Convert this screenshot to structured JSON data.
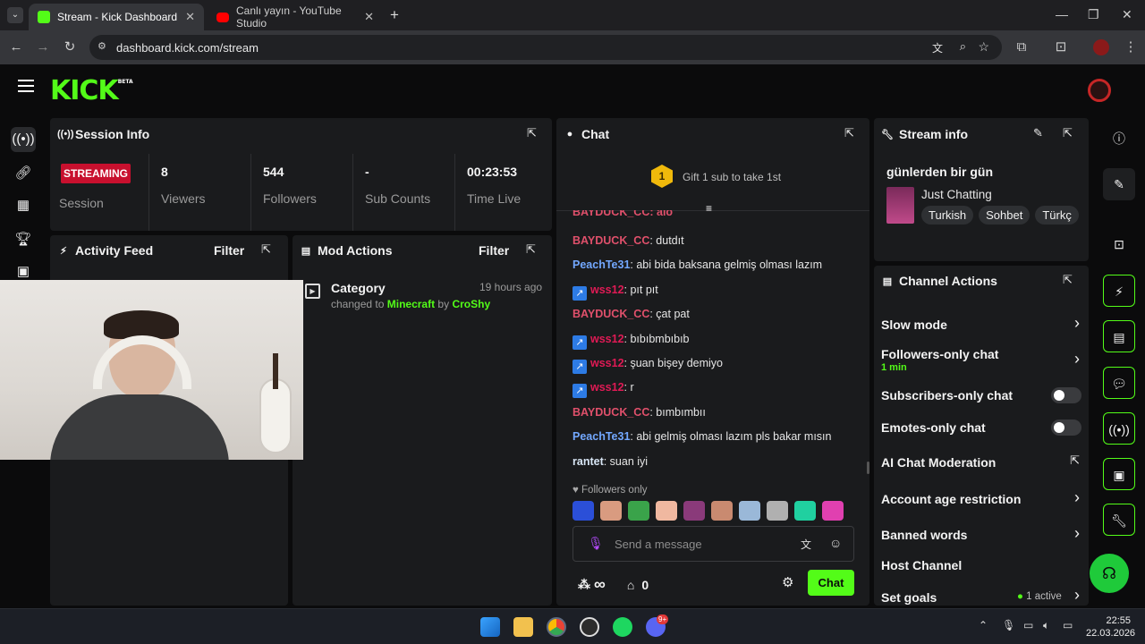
{
  "browser": {
    "tabs": [
      {
        "title": "Stream - Kick Dashboard",
        "active": true
      },
      {
        "title": "Canlı yayın - YouTube Studio",
        "active": false
      }
    ],
    "url": "dashboard.kick.com/stream",
    "close_glyph": "✕",
    "new_tab_glyph": "+"
  },
  "header": {
    "logo": "KICK",
    "logo_badge": "BETA"
  },
  "session": {
    "title": "Session Info",
    "status_badge": "STREAMING",
    "session_label": "Session",
    "stats": [
      {
        "value": "8",
        "label": "Viewers"
      },
      {
        "value": "544",
        "label": "Followers"
      },
      {
        "value": "-",
        "label": "Sub Counts"
      },
      {
        "value": "00:23:53",
        "label": "Time Live"
      }
    ]
  },
  "activity": {
    "title": "Activity Feed",
    "filter": "Filter"
  },
  "mod": {
    "title": "Mod Actions",
    "filter": "Filter",
    "entry": {
      "title": "Category",
      "time": "19 hours ago",
      "prefix": "changed to",
      "category": "Minecraft",
      "by": "by",
      "user": "CroShy"
    }
  },
  "chat": {
    "title": "Chat",
    "gift_count": "1",
    "gift_text": "Gift 1 sub to take 1st",
    "partial_line": "BAYDUCK_CC: alo",
    "messages": [
      {
        "user": "BAYDUCK_CC",
        "color": "red",
        "badge": false,
        "text": ": dutdıt"
      },
      {
        "user": "PeachTe31",
        "color": "blue",
        "badge": false,
        "text": ": abi bida baksana gelmiş olması lazım"
      },
      {
        "user": "wss12",
        "color": "pink",
        "badge": true,
        "text": ": pıt pıt"
      },
      {
        "user": "BAYDUCK_CC",
        "color": "red",
        "badge": false,
        "text": ": çat pat"
      },
      {
        "user": "wss12",
        "color": "pink",
        "badge": true,
        "text": ": bıbıbmbıbıb"
      },
      {
        "user": "wss12",
        "color": "pink",
        "badge": true,
        "text": ": şuan bişey demiyo"
      },
      {
        "user": "wss12",
        "color": "pink",
        "badge": true,
        "text": ": r"
      },
      {
        "user": "BAYDUCK_CC",
        "color": "red",
        "badge": false,
        "text": ": bımbımbıı"
      },
      {
        "user": "PeachTe31",
        "color": "blue",
        "badge": false,
        "text": ": abi gelmiş olması lazım pls bakar mısın"
      },
      {
        "user": "rantet",
        "color": "white",
        "badge": false,
        "text": ": suan iyi"
      }
    ],
    "followers_only": "Followers only",
    "input_placeholder": "Send a message",
    "infinity": "∞",
    "store_count": "0",
    "send_label": "Chat"
  },
  "stream_info": {
    "title": "Stream info",
    "stream_title": "günlerden bir gün",
    "category": "Just Chatting",
    "tags": [
      "Turkish",
      "Sohbet",
      "Türkç"
    ]
  },
  "channel_actions": {
    "title": "Channel Actions",
    "items": [
      {
        "label": "Slow mode",
        "control": "chevron"
      },
      {
        "label": "Followers-only chat",
        "sub": "1 min",
        "control": "chevron"
      },
      {
        "label": "Subscribers-only chat",
        "control": "toggle",
        "on": false
      },
      {
        "label": "Emotes-only chat",
        "control": "toggle",
        "on": false
      },
      {
        "label": "AI Chat Moderation",
        "control": "external"
      },
      {
        "label": "Account age restriction",
        "control": "chevron"
      },
      {
        "label": "Banned words",
        "control": "chevron"
      },
      {
        "label": "Host Channel",
        "control": "none"
      },
      {
        "label": "Set goals",
        "status": "1 active",
        "control": "chevron"
      }
    ]
  },
  "taskbar": {
    "time": "22:55",
    "date": "22.03.2026",
    "discord_badge": "9+"
  },
  "colors": {
    "kick_green": "#53fc18",
    "streaming_red": "#c8102e",
    "panel": "#1a1b1d"
  }
}
